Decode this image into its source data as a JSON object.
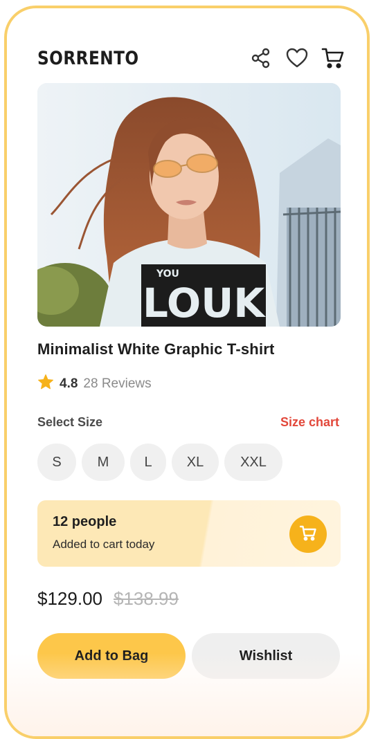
{
  "header": {
    "brand": "SORRENTO",
    "icons": [
      "share-icon",
      "heart-icon",
      "cart-icon"
    ]
  },
  "product": {
    "image_alt": "",
    "shirt_text": "LOUK",
    "shirt_text_top": "YOU",
    "title": "Minimalist White Graphic T-shirt",
    "rating": "4.8",
    "reviews": "28 Reviews"
  },
  "size": {
    "label": "Select Size",
    "chart_link": "Size chart",
    "options": [
      "S",
      "M",
      "L",
      "XL",
      "XXL"
    ]
  },
  "promo": {
    "count": "12 people",
    "subtext": "Added to cart today"
  },
  "pricing": {
    "price": "$129.00",
    "original_price": "$138.99"
  },
  "actions": {
    "primary": "Add to Bag",
    "secondary": "Wishlist"
  },
  "colors": {
    "frame": "#f9cf6a",
    "primary_button": "#fdc74a",
    "accent_cart": "#f6b21b",
    "size_chart": "#e2473a",
    "star": "#f6b21b"
  }
}
